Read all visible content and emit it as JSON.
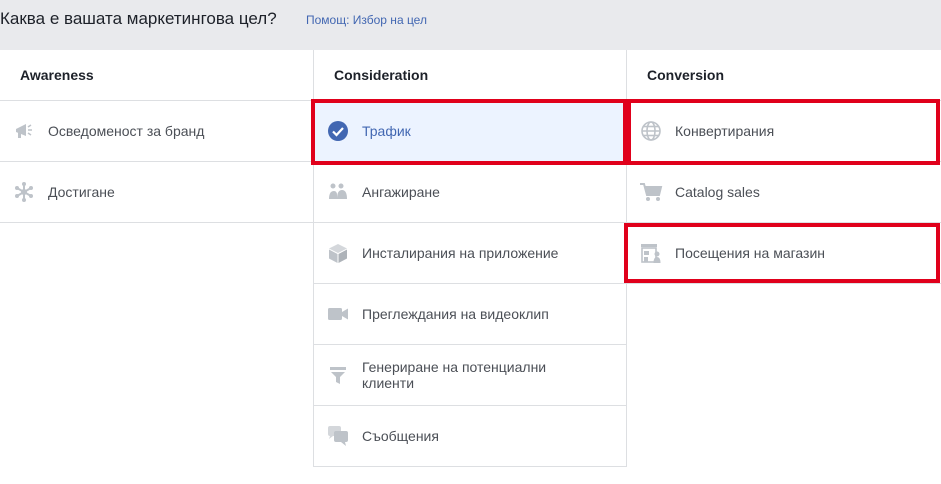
{
  "header": {
    "title": "Каква е вашата маркетингова цел?",
    "help_link": "Помощ: Избор на цел"
  },
  "columns": [
    {
      "heading": "Awareness",
      "items": [
        {
          "label": "Осведоменост за бранд",
          "icon": "megaphone-icon"
        },
        {
          "label": "Достигане",
          "icon": "reach-asterisk-icon"
        }
      ]
    },
    {
      "heading": "Consideration",
      "items": [
        {
          "label": "Трафик",
          "icon": "checkmark-circle-icon",
          "selected": true
        },
        {
          "label": "Ангажиране",
          "icon": "people-icon"
        },
        {
          "label": "Инсталирания на приложение",
          "icon": "cube-icon"
        },
        {
          "label": "Преглеждания на видеоклип",
          "icon": "video-camera-icon"
        },
        {
          "label": "Генериране на потенциални клиенти",
          "icon": "funnel-icon"
        },
        {
          "label": "Съобщения",
          "icon": "chat-bubbles-icon"
        }
      ]
    },
    {
      "heading": "Conversion",
      "items": [
        {
          "label": "Конвертирания",
          "icon": "globe-icon"
        },
        {
          "label": "Catalog sales",
          "icon": "shopping-cart-icon"
        },
        {
          "label": "Посещения на магазин",
          "icon": "store-icon"
        }
      ]
    }
  ],
  "colors": {
    "accent": "#4267b2",
    "selected_bg": "#ecf3ff",
    "highlight": "#e0001b",
    "icon_gray": "#bec3c9"
  }
}
